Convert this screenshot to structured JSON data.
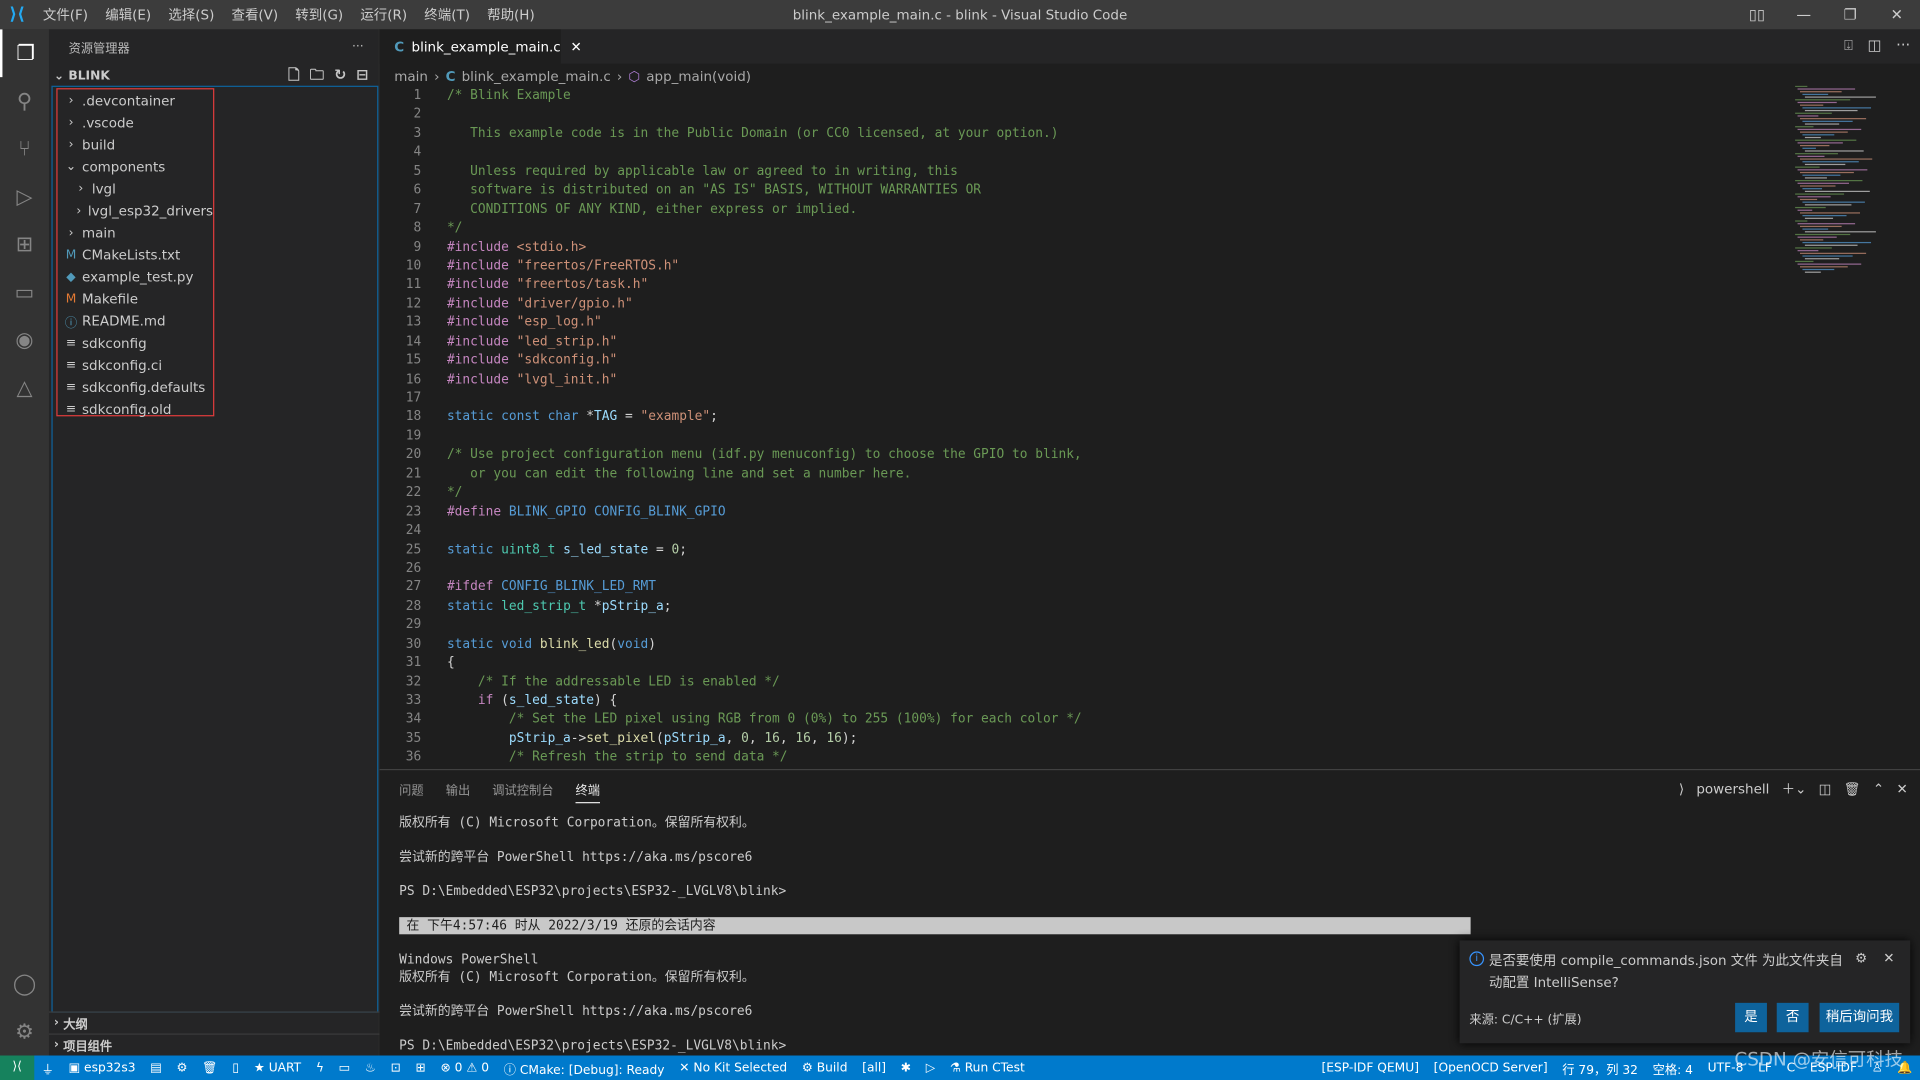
{
  "window": {
    "title": "blink_example_main.c - blink - Visual Studio Code",
    "menu": [
      "文件(F)",
      "编辑(E)",
      "选择(S)",
      "查看(V)",
      "转到(G)",
      "运行(R)",
      "终端(T)",
      "帮助(H)"
    ]
  },
  "sidebar": {
    "title": "资源管理器",
    "folder": "BLINK",
    "items": [
      {
        "label": ".devcontainer",
        "type": "folder",
        "depth": 0
      },
      {
        "label": ".vscode",
        "type": "folder",
        "depth": 0
      },
      {
        "label": "build",
        "type": "folder",
        "depth": 0
      },
      {
        "label": "components",
        "type": "folder-open",
        "depth": 0
      },
      {
        "label": "lvgl",
        "type": "folder",
        "depth": 1
      },
      {
        "label": "lvgl_esp32_drivers",
        "type": "folder",
        "depth": 1
      },
      {
        "label": "main",
        "type": "folder",
        "depth": 0
      },
      {
        "label": "CMakeLists.txt",
        "type": "cmake",
        "depth": 0
      },
      {
        "label": "example_test.py",
        "type": "python",
        "depth": 0
      },
      {
        "label": "Makefile",
        "type": "makefile",
        "depth": 0
      },
      {
        "label": "README.md",
        "type": "info",
        "depth": 0
      },
      {
        "label": "sdkconfig",
        "type": "file",
        "depth": 0
      },
      {
        "label": "sdkconfig.ci",
        "type": "file",
        "depth": 0
      },
      {
        "label": "sdkconfig.defaults",
        "type": "file",
        "depth": 0
      },
      {
        "label": "sdkconfig.old",
        "type": "file",
        "depth": 0
      }
    ],
    "outline": "大纲",
    "project_components": "项目组件"
  },
  "editor": {
    "tab": "blink_example_main.c",
    "breadcrumb": [
      "main",
      "blink_example_main.c",
      "app_main(void)"
    ],
    "lines": [
      [
        [
          "cm",
          "/* Blink Example"
        ]
      ],
      [],
      [
        [
          "cm",
          "   This example code is in the Public Domain (or CC0 licensed, at your option.)"
        ]
      ],
      [],
      [
        [
          "cm",
          "   Unless required by applicable law or agreed to in writing, this"
        ]
      ],
      [
        [
          "cm",
          "   software is distributed on an \"AS IS\" BASIS, WITHOUT WARRANTIES OR"
        ]
      ],
      [
        [
          "cm",
          "   CONDITIONS OF ANY KIND, either express or implied."
        ]
      ],
      [
        [
          "cm",
          "*/"
        ]
      ],
      [
        [
          "pp",
          "#include "
        ],
        [
          "st",
          "<stdio.h>"
        ]
      ],
      [
        [
          "pp",
          "#include "
        ],
        [
          "st",
          "\"freertos/FreeRTOS.h\""
        ]
      ],
      [
        [
          "pp",
          "#include "
        ],
        [
          "st",
          "\"freertos/task.h\""
        ]
      ],
      [
        [
          "pp",
          "#include "
        ],
        [
          "st",
          "\"driver/gpio.h\""
        ]
      ],
      [
        [
          "pp",
          "#include "
        ],
        [
          "st",
          "\"esp_log.h\""
        ]
      ],
      [
        [
          "pp",
          "#include "
        ],
        [
          "st",
          "\"led_strip.h\""
        ]
      ],
      [
        [
          "pp",
          "#include "
        ],
        [
          "st",
          "\"sdkconfig.h\""
        ]
      ],
      [
        [
          "pp",
          "#include "
        ],
        [
          "st",
          "\"lvgl_init.h\""
        ]
      ],
      [],
      [
        [
          "kw",
          "static const char "
        ],
        [
          "pl",
          "*"
        ],
        [
          "va",
          "TAG"
        ],
        [
          "pl",
          " = "
        ],
        [
          "st",
          "\"example\""
        ],
        [
          "pl",
          ";"
        ]
      ],
      [],
      [
        [
          "cm",
          "/* Use project configuration menu (idf.py menuconfig) to choose the GPIO to blink,"
        ]
      ],
      [
        [
          "cm",
          "   or you can edit the following line and set a number here."
        ]
      ],
      [
        [
          "cm",
          "*/"
        ]
      ],
      [
        [
          "pp",
          "#define "
        ],
        [
          "kw",
          "BLINK_GPIO CONFIG_BLINK_GPIO"
        ]
      ],
      [],
      [
        [
          "kw",
          "static "
        ],
        [
          "ty",
          "uint8_t"
        ],
        [
          "pl",
          " "
        ],
        [
          "va",
          "s_led_state"
        ],
        [
          "pl",
          " = "
        ],
        [
          "nu",
          "0"
        ],
        [
          "pl",
          ";"
        ]
      ],
      [],
      [
        [
          "pp",
          "#ifdef "
        ],
        [
          "kw",
          "CONFIG_BLINK_LED_RMT"
        ]
      ],
      [
        [
          "kw",
          "static "
        ],
        [
          "ty",
          "led_strip_t"
        ],
        [
          "pl",
          " *"
        ],
        [
          "va",
          "pStrip_a"
        ],
        [
          "pl",
          ";"
        ]
      ],
      [],
      [
        [
          "kw",
          "static void "
        ],
        [
          "fn",
          "blink_led"
        ],
        [
          "pl",
          "("
        ],
        [
          "kw",
          "void"
        ],
        [
          "pl",
          ")"
        ]
      ],
      [
        [
          "pl",
          "{"
        ]
      ],
      [
        [
          "cm",
          "    /* If the addressable LED is enabled */"
        ]
      ],
      [
        [
          "pp",
          "    if "
        ],
        [
          "pl",
          "("
        ],
        [
          "va",
          "s_led_state"
        ],
        [
          "pl",
          ") {"
        ]
      ],
      [
        [
          "cm",
          "        /* Set the LED pixel using RGB from 0 (0%) to 255 (100%) for each color */"
        ]
      ],
      [
        [
          "pl",
          "        "
        ],
        [
          "va",
          "pStrip_a"
        ],
        [
          "pl",
          "->"
        ],
        [
          "fn",
          "set_pixel"
        ],
        [
          "pl",
          "("
        ],
        [
          "va",
          "pStrip_a"
        ],
        [
          "pl",
          ", "
        ],
        [
          "nu",
          "0"
        ],
        [
          "pl",
          ", "
        ],
        [
          "nu",
          "16"
        ],
        [
          "pl",
          ", "
        ],
        [
          "nu",
          "16"
        ],
        [
          "pl",
          ", "
        ],
        [
          "nu",
          "16"
        ],
        [
          "pl",
          ");"
        ]
      ],
      [
        [
          "cm",
          "        /* Refresh the strip to send data */"
        ]
      ]
    ]
  },
  "panel": {
    "tabs": [
      "问题",
      "输出",
      "调试控制台",
      "终端"
    ],
    "active_tab": "终端",
    "shell": "powershell",
    "terminal": [
      "版权所有 (C) Microsoft Corporation。保留所有权利。",
      "",
      "尝试新的跨平台 PowerShell https://aka.ms/pscore6",
      "",
      "PS D:\\Embedded\\ESP32\\projects\\ESP32-_LVGLV8\\blink>",
      "",
      "在 下午4:57:46 时从 2022/3/19 还原的会话内容",
      "",
      "Windows PowerShell",
      "版权所有 (C) Microsoft Corporation。保留所有权利。",
      "",
      "尝试新的跨平台 PowerShell https://aka.ms/pscore6",
      "",
      "PS D:\\Embedded\\ESP32\\projects\\ESP32-_LVGLV8\\blink>"
    ]
  },
  "notification": {
    "message": "是否要使用 compile_commands.json 文件 为此文件夹自动配置 IntelliSense?",
    "source": "来源: C/C++ (扩展)",
    "buttons": [
      "是",
      "否",
      "稍后询问我"
    ]
  },
  "statusbar": {
    "left": [
      "esp32s3",
      "UART",
      "⊗ 0 ⚠ 0",
      "CMake: [Debug]: Ready",
      "No Kit Selected",
      "Build",
      "[all]",
      "Run CTest"
    ],
    "right": [
      "[ESP-IDF QEMU]",
      "[OpenOCD Server]",
      "行 79，列 32",
      "空格: 4",
      "UTF-8",
      "LF",
      "C",
      "ESP-IDF"
    ]
  },
  "watermark": "CSDN @安信可科技",
  "colors": {
    "accent": "#007acc",
    "remote": "#16825d",
    "highlight_box": "#e03c3c"
  }
}
